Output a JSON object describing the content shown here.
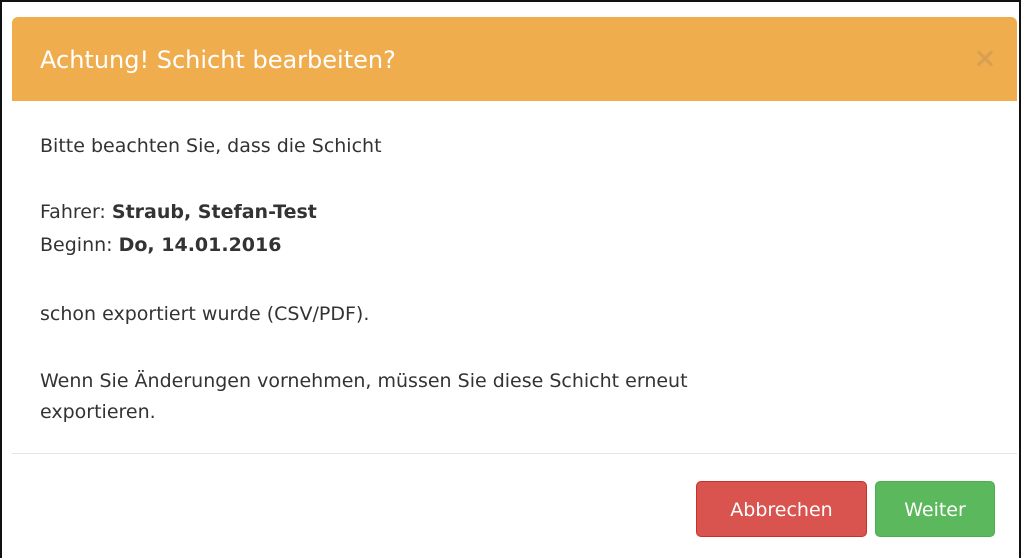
{
  "dialog": {
    "title": "Achtung! Schicht bearbeiten?",
    "close_symbol": "×",
    "header_color": "#f0ad4e"
  },
  "body": {
    "intro": "Bitte beachten Sie, dass die Schicht",
    "driver_label": "Fahrer:",
    "driver_value": "Straub, Stefan-Test",
    "start_label": "Beginn:",
    "start_value": "Do, 14.01.2016",
    "exported_text": "schon exportiert wurde (CSV/PDF).",
    "warning_line1": "Wenn Sie Änderungen vornehmen, müssen Sie diese Schicht erneut",
    "warning_line2": "exportieren."
  },
  "footer": {
    "cancel_label": "Abbrechen",
    "continue_label": "Weiter",
    "cancel_color": "#d9534f",
    "continue_color": "#5cb85c"
  }
}
